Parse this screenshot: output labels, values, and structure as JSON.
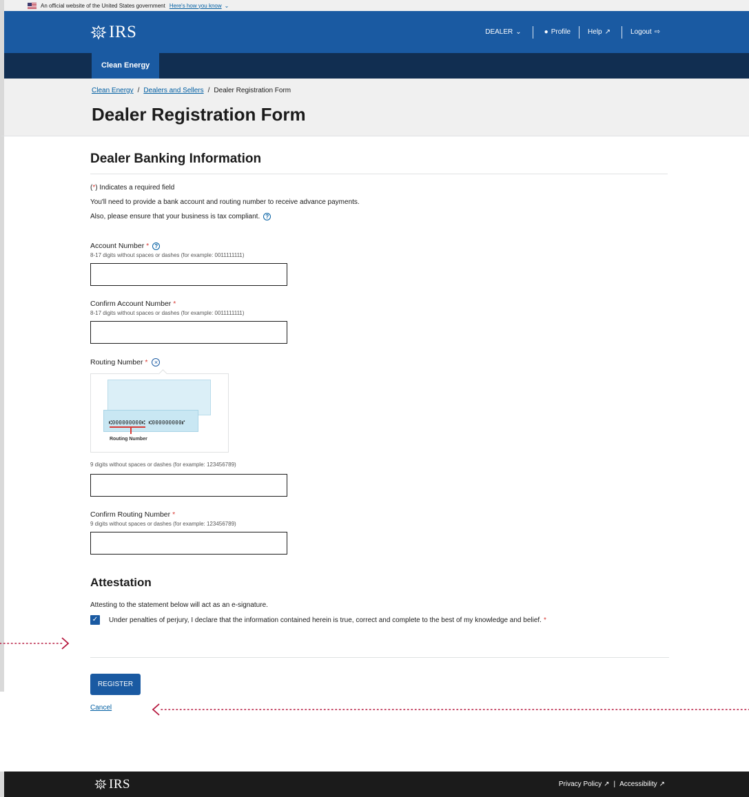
{
  "gov_banner": {
    "text": "An official website of the United States government",
    "link": "Here's how you know"
  },
  "header": {
    "logo": "IRS",
    "util_nav": {
      "dealer": "DEALER",
      "profile": "Profile",
      "help": "Help",
      "logout": "Logout"
    },
    "nav_tab": "Clean Energy"
  },
  "breadcrumb": {
    "items": [
      "Clean Energy",
      "Dealers and Sellers"
    ],
    "current": "Dealer Registration Form"
  },
  "page_title": "Dealer Registration Form",
  "banking": {
    "section_title": "Dealer Banking Information",
    "required_note_mark": "*",
    "required_note": ") Indicates a required field",
    "info_1": "You'll need to provide a bank account and routing number to receive advance payments.",
    "info_2": "Also, please ensure that your business is tax compliant.",
    "account_number": {
      "label": "Account Number",
      "hint": "8-17 digits without spaces or dashes (for example: 0011111111)",
      "value": ""
    },
    "confirm_account_number": {
      "label": "Confirm Account Number",
      "hint": "8-17 digits without spaces or dashes (for example: 0011111111)",
      "value": ""
    },
    "routing_number": {
      "label": "Routing Number",
      "image_micr": "⑆000000000⑆ ⑆000000000⑈",
      "image_caption": "Routing Number",
      "hint": "9 digits without spaces or dashes (for example: 123456789)",
      "value": ""
    },
    "confirm_routing_number": {
      "label": "Confirm Routing Number",
      "hint": "9 digits without spaces or dashes (for example: 123456789)",
      "value": ""
    }
  },
  "attestation": {
    "section_title": "Attestation",
    "note": "Attesting to the statement below will act as an e-signature.",
    "statement": "Under penalties of perjury, I declare that the information contained herein is true, correct and complete to the best of my knowledge and belief.",
    "checked": true
  },
  "actions": {
    "register": "REGISTER",
    "cancel": "Cancel"
  },
  "footer": {
    "logo": "IRS",
    "privacy": "Privacy Policy",
    "separator": "|",
    "accessibility": "Accessibility"
  },
  "colors": {
    "primary": "#1a5aa2",
    "nav_dark": "#112e51",
    "required": "#d83933",
    "annotation": "#b5173d"
  }
}
